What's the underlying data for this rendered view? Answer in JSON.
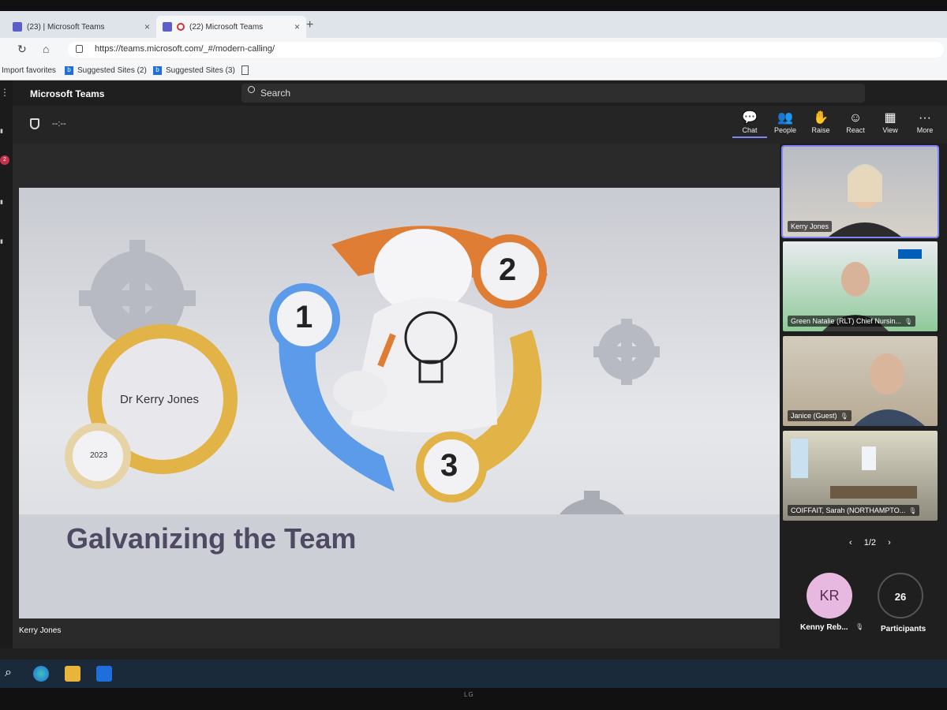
{
  "browser": {
    "tabs": [
      {
        "label": "(23) | Microsoft Teams",
        "close": "×"
      },
      {
        "label": "(22) Microsoft Teams",
        "close": "×"
      }
    ],
    "new_tab": "+",
    "url": "https://teams.microsoft.com/_#/modern-calling/",
    "favorites": [
      {
        "label": "Import favorites"
      },
      {
        "label": "Suggested Sites (2)"
      },
      {
        "label": "Suggested Sites (3)"
      }
    ]
  },
  "teams": {
    "app_title": "Microsoft Teams",
    "search_placeholder": "Search",
    "rail_badge": "2"
  },
  "meeting": {
    "timer": "--:--",
    "toolbar": [
      {
        "label": "Chat",
        "icon": "chat-icon"
      },
      {
        "label": "People",
        "icon": "people-icon"
      },
      {
        "label": "Raise",
        "icon": "raise-hand-icon"
      },
      {
        "label": "React",
        "icon": "react-icon"
      },
      {
        "label": "View",
        "icon": "view-grid-icon"
      },
      {
        "label": "More",
        "icon": "more-icon"
      }
    ],
    "presenter": "Kerry Jones"
  },
  "slide": {
    "name": "Dr Kerry Jones",
    "year": "2023",
    "steps": [
      "1",
      "2",
      "3"
    ],
    "title": "Galvanizing the Team"
  },
  "participants": {
    "tiles": [
      {
        "name": "Kerry Jones",
        "muted": false
      },
      {
        "name": "Green Natalie (RLT) Chief Nursin...",
        "muted": true
      },
      {
        "name": "Janice (Guest)",
        "muted": true
      },
      {
        "name": "COIFFAIT, Sarah (NORTHAMPTO...",
        "muted": true
      }
    ],
    "page": "1/2",
    "avatar_initials": "KR",
    "avatar_name": "Kenny Reb...",
    "count": "26",
    "count_label": "Participants"
  },
  "colors": {
    "accent": "#7f85f5",
    "orange": "#e07d35",
    "blue": "#5b9bea",
    "gold": "#e2b347",
    "title": "#4e4a63"
  }
}
